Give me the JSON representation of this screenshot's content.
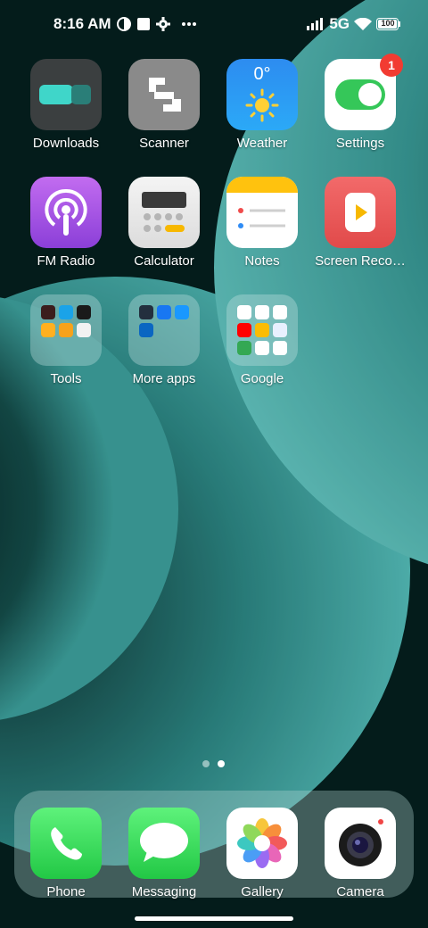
{
  "status_bar": {
    "time": "8:16 AM",
    "network": "5G",
    "battery": "100",
    "icons": [
      "data-saver-icon",
      "square-notification-icon",
      "gear-icon",
      "more-dots-icon",
      "signal-icon",
      "wifi-icon",
      "battery-icon"
    ]
  },
  "apps": {
    "downloads": {
      "label": "Downloads",
      "icon": "downloads-icon"
    },
    "scanner": {
      "label": "Scanner",
      "icon": "scanner-icon"
    },
    "weather": {
      "label": "Weather",
      "icon": "weather-icon",
      "temperature": "0°"
    },
    "settings": {
      "label": "Settings",
      "icon": "toggle-icon",
      "badge": "1"
    },
    "fm_radio": {
      "label": "FM Radio",
      "icon": "podcast-icon"
    },
    "calculator": {
      "label": "Calculator",
      "icon": "calculator-icon"
    },
    "notes": {
      "label": "Notes",
      "icon": "notes-icon"
    },
    "screen_recorder": {
      "label": "Screen Reco…",
      "icon": "screen-record-icon"
    }
  },
  "folders": {
    "tools": {
      "label": "Tools"
    },
    "more_apps": {
      "label": "More apps"
    },
    "google": {
      "label": "Google"
    }
  },
  "dock": {
    "phone": {
      "label": "Phone",
      "icon": "phone-icon"
    },
    "messaging": {
      "label": "Messaging",
      "icon": "chat-bubble-icon"
    },
    "gallery": {
      "label": "Gallery",
      "icon": "flower-icon"
    },
    "camera": {
      "label": "Camera",
      "icon": "camera-lens-icon"
    }
  },
  "page_indicator": {
    "pages": 2,
    "active": 2
  },
  "colors": {
    "accent_teal": "#4bbdb8",
    "badge_red": "#f23b32",
    "background": "#06201f"
  }
}
